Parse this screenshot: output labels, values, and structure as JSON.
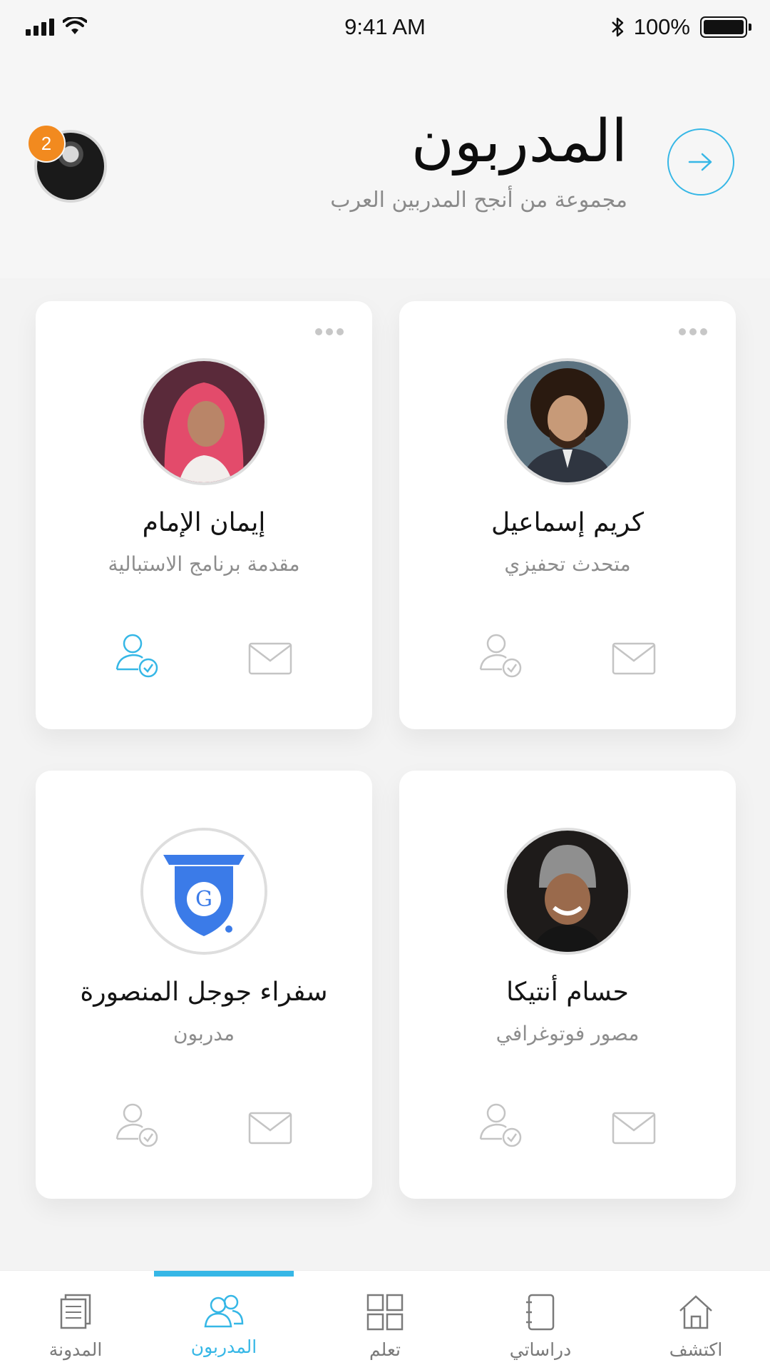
{
  "status_bar": {
    "time": "9:41 AM",
    "battery": "100%"
  },
  "header": {
    "title": "المدربون",
    "subtitle": "مجموعة من أنجح المدربين العرب",
    "notification_count": "2"
  },
  "trainers": [
    {
      "name": "كريم إسماعيل",
      "role": "متحدث تحفيزي",
      "followed": false
    },
    {
      "name": "إيمان الإمام",
      "role": "مقدمة برنامج الاستبالية",
      "followed": true
    },
    {
      "name": "حسام أنتيكا",
      "role": "مصور فوتوغرافي",
      "followed": false
    },
    {
      "name": "سفراء جوجل المنصورة",
      "role": "مدربون",
      "followed": false
    }
  ],
  "tabs": [
    {
      "label": "اكتشف",
      "icon": "home-icon"
    },
    {
      "label": "دراساتي",
      "icon": "notebook-icon"
    },
    {
      "label": "تعلم",
      "icon": "grid-icon"
    },
    {
      "label": "المدربون",
      "icon": "users-icon",
      "active": true
    },
    {
      "label": "المدونة",
      "icon": "blog-icon"
    }
  ],
  "colors": {
    "accent": "#36b7e6",
    "badge": "#f28a1f",
    "inactive_icon": "#c4c4c4"
  }
}
